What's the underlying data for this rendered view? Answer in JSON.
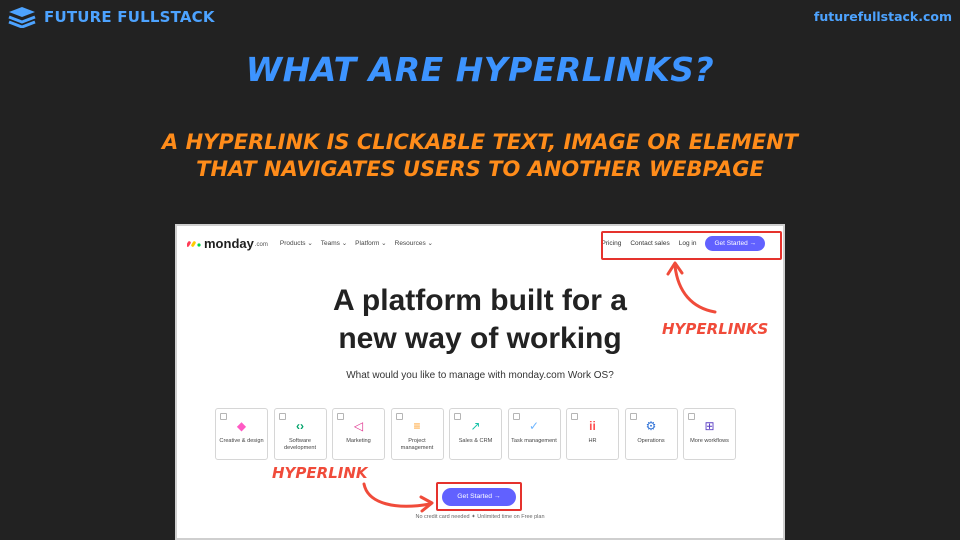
{
  "brand": {
    "name": "FUTURE FULLSTACK",
    "url": "futurefullstack.com",
    "color": "#4da3ff"
  },
  "title": "WHAT ARE HYPERLINKS?",
  "subtitle": {
    "line1": "A HYPERLINK IS CLICKABLE TEXT, IMAGE OR ELEMENT",
    "line2": "THAT NAVIGATES USERS TO ANOTHER WEBPAGE"
  },
  "screenshot": {
    "logo_word": "monday",
    "logo_suffix": ".com",
    "nav_menu": [
      "Products ⌄",
      "Teams ⌄",
      "Platform ⌄",
      "Resources ⌄"
    ],
    "nav_links": [
      "Pricing",
      "Contact sales",
      "Log in"
    ],
    "nav_cta": "Get Started →",
    "hero_line1": "A platform built for a",
    "hero_line2": "new way of working",
    "question": "What would you like to manage with monday.com Work OS?",
    "cards": [
      {
        "icon": "shapes-icon",
        "glyph": "◆",
        "color": "#ff5ac4",
        "label": "Creative & design"
      },
      {
        "icon": "code-icon",
        "glyph": "‹›",
        "color": "#00a36a",
        "label": "Software development"
      },
      {
        "icon": "megaphone-icon",
        "glyph": "◁",
        "color": "#e0338f",
        "label": "Marketing"
      },
      {
        "icon": "gantt-icon",
        "glyph": "≡",
        "color": "#ff9a1f",
        "label": "Project management"
      },
      {
        "icon": "trend-icon",
        "glyph": "↗",
        "color": "#17c3a8",
        "label": "Sales & CRM"
      },
      {
        "icon": "check-icon",
        "glyph": "✓",
        "color": "#6fb6ff",
        "label": "Task management"
      },
      {
        "icon": "people-icon",
        "glyph": "ii",
        "color": "#ff4f4f",
        "label": "HR"
      },
      {
        "icon": "gears-icon",
        "glyph": "⚙",
        "color": "#2b6fd6",
        "label": "Operations"
      },
      {
        "icon": "plus-box-icon",
        "glyph": "⊞",
        "color": "#5b3fc4",
        "label": "More workflows"
      }
    ],
    "cta_main": "Get Started →",
    "footnote": "No credit card needed  ✦  Unlimited time on Free plan"
  },
  "annotations": {
    "plural": "HYPERLINKS",
    "singular": "HYPERLINK",
    "color": "#f04b3a"
  }
}
